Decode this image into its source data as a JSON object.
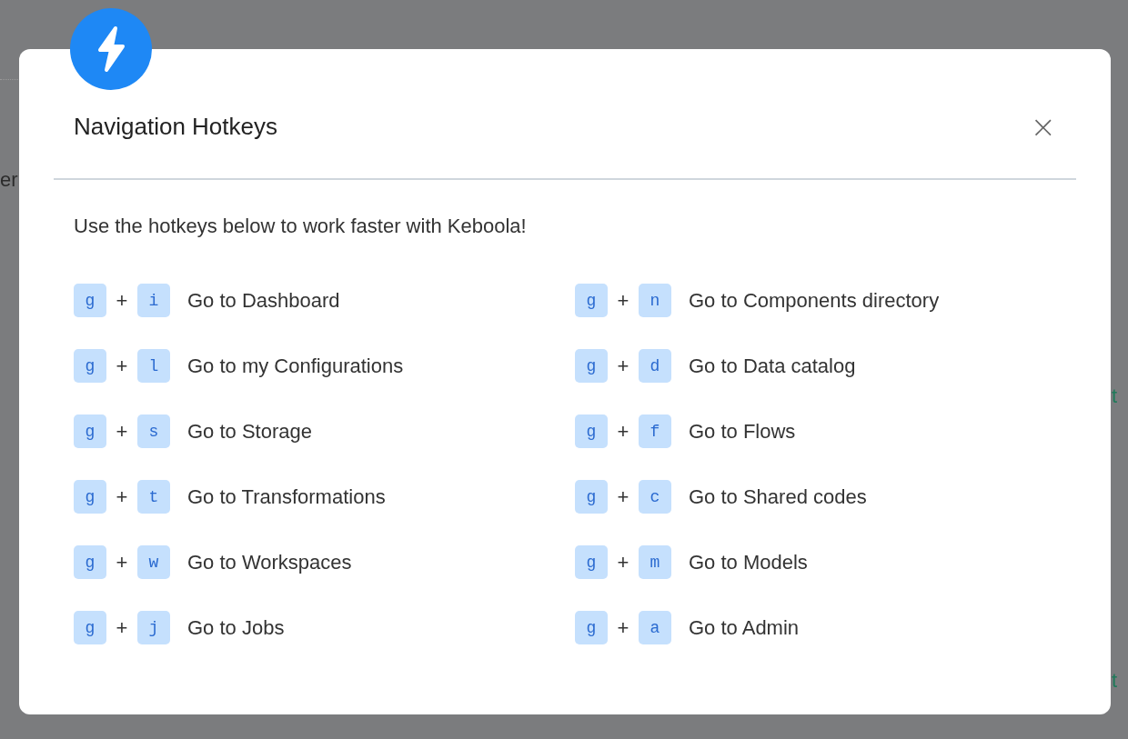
{
  "background": {
    "texts": [
      {
        "text": "er",
        "kind": "plain"
      },
      {
        "text": "t",
        "kind": "link"
      },
      {
        "text": "t",
        "kind": "link"
      }
    ]
  },
  "dialog": {
    "title": "Navigation Hotkeys",
    "close": "×",
    "intro": "Use the hotkeys below to work faster with Keboola!",
    "columns": [
      [
        {
          "keys": [
            "g",
            "i"
          ],
          "label": "Go to Dashboard"
        },
        {
          "keys": [
            "g",
            "l"
          ],
          "label": "Go to my Configurations"
        },
        {
          "keys": [
            "g",
            "s"
          ],
          "label": "Go to Storage"
        },
        {
          "keys": [
            "g",
            "t"
          ],
          "label": "Go to Transformations"
        },
        {
          "keys": [
            "g",
            "w"
          ],
          "label": "Go to Workspaces"
        },
        {
          "keys": [
            "g",
            "j"
          ],
          "label": "Go to Jobs"
        }
      ],
      [
        {
          "keys": [
            "g",
            "n"
          ],
          "label": "Go to Components directory"
        },
        {
          "keys": [
            "g",
            "d"
          ],
          "label": "Go to Data catalog"
        },
        {
          "keys": [
            "g",
            "f"
          ],
          "label": "Go to Flows"
        },
        {
          "keys": [
            "g",
            "c"
          ],
          "label": "Go to Shared codes"
        },
        {
          "keys": [
            "g",
            "m"
          ],
          "label": "Go to Models"
        },
        {
          "keys": [
            "g",
            "a"
          ],
          "label": "Go to Admin"
        }
      ]
    ],
    "separator": "+"
  }
}
